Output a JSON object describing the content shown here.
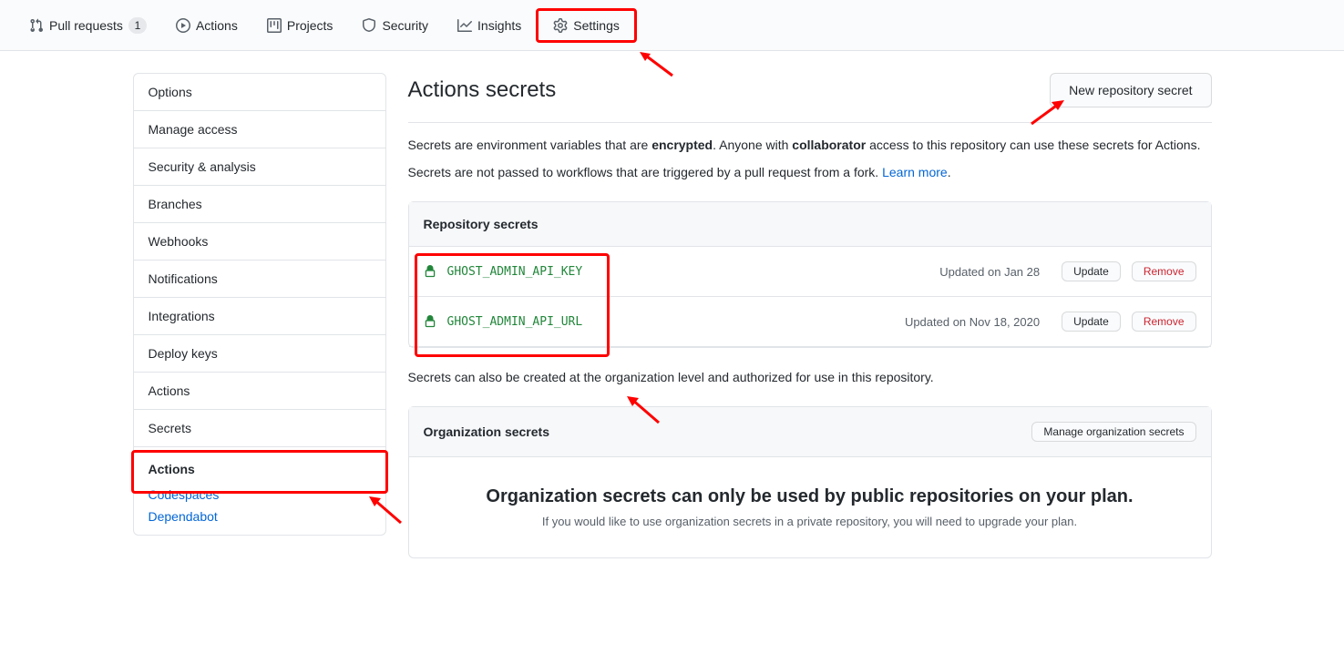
{
  "topnav": {
    "pull_requests": "Pull requests",
    "pr_count": "1",
    "actions": "Actions",
    "projects": "Projects",
    "security": "Security",
    "insights": "Insights",
    "settings": "Settings"
  },
  "sidebar": {
    "items": [
      "Options",
      "Manage access",
      "Security & analysis",
      "Branches",
      "Webhooks",
      "Notifications",
      "Integrations",
      "Deploy keys",
      "Actions",
      "Secrets"
    ],
    "sub_header": "Actions",
    "sub_items": [
      "Codespaces",
      "Dependabot"
    ]
  },
  "page": {
    "title": "Actions secrets",
    "new_secret_btn": "New repository secret",
    "desc1_a": "Secrets are environment variables that are ",
    "desc1_b": "encrypted",
    "desc1_c": ". Anyone with ",
    "desc1_d": "collaborator",
    "desc1_e": " access to this repository can use these secrets for Actions.",
    "desc2_a": "Secrets are not passed to workflows that are triggered by a pull request from a fork. ",
    "desc2_link": "Learn more",
    "desc2_b": ".",
    "repo_secrets_header": "Repository secrets",
    "secrets": [
      {
        "name": "GHOST_ADMIN_API_KEY",
        "updated": "Updated on Jan 28"
      },
      {
        "name": "GHOST_ADMIN_API_URL",
        "updated": "Updated on Nov 18, 2020"
      }
    ],
    "update_btn": "Update",
    "remove_btn": "Remove",
    "org_note": "Secrets can also be created at the organization level and authorized for use in this repository.",
    "org_secrets_header": "Organization secrets",
    "manage_org_btn": "Manage organization secrets",
    "org_msg_title": "Organization secrets can only be used by public repositories on your plan.",
    "org_msg_body": "If you would like to use organization secrets in a private repository, you will need to upgrade your plan."
  }
}
